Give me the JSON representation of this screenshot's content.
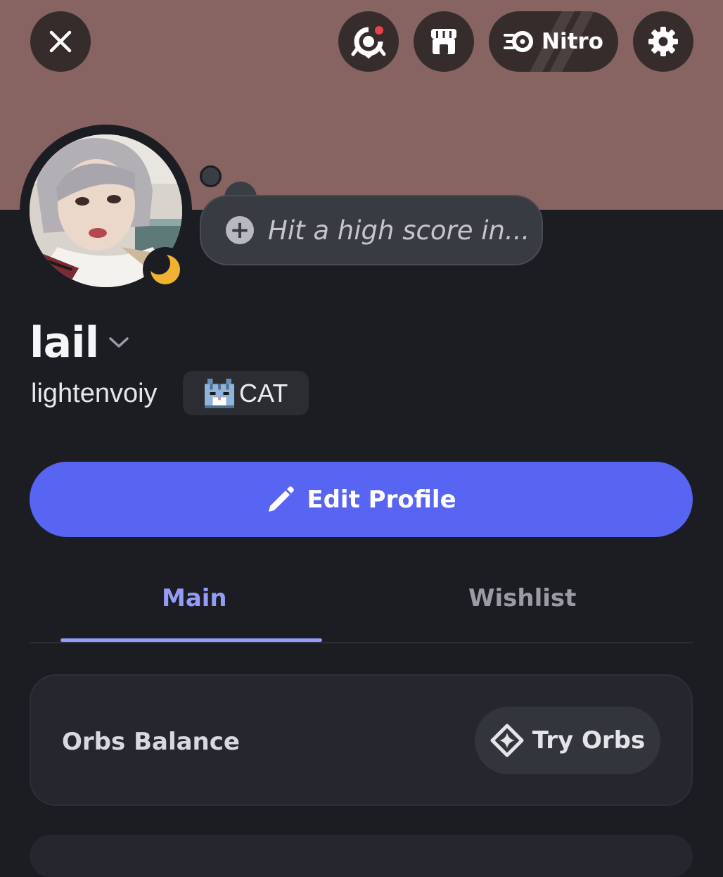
{
  "header": {
    "close_icon": "close-icon",
    "quests_icon": "quests-badge-icon",
    "shop_icon": "shop-icon",
    "nitro_label": "Nitro",
    "settings_icon": "gear-icon",
    "notification_color": "#ed4245"
  },
  "profile": {
    "banner_color": "#876362",
    "status": "idle",
    "status_color": "#f0b232",
    "custom_status_placeholder": "Hit a high score in...",
    "display_name": "lail",
    "username": "lightenvoiy",
    "tag": {
      "icon": "pixel-cat-icon",
      "label": "CAT"
    }
  },
  "actions": {
    "edit_profile_label": "Edit Profile",
    "accent_color": "#5865f2"
  },
  "tabs": [
    {
      "label": "Main",
      "active": true
    },
    {
      "label": "Wishlist",
      "active": false
    }
  ],
  "orbs": {
    "label": "Orbs Balance",
    "button_label": "Try Orbs"
  }
}
